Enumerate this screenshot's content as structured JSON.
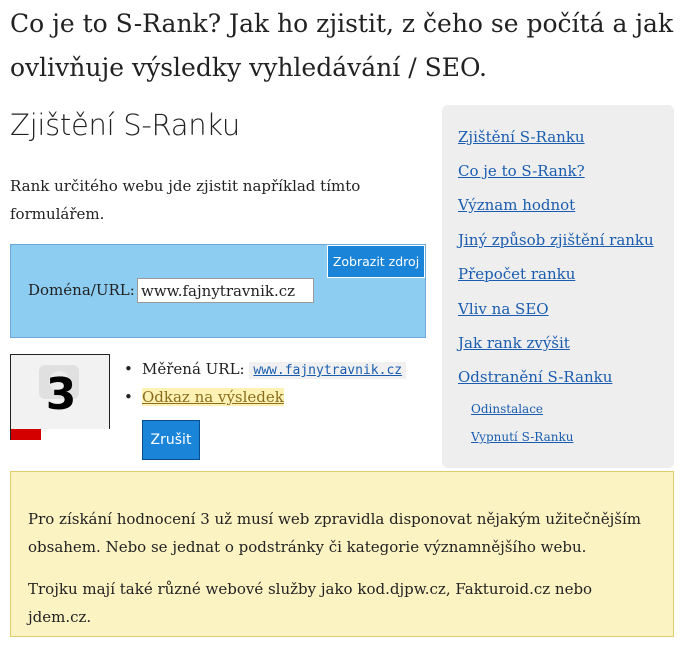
{
  "page_title": "Co je to S-Rank? Jak ho zjistit, z čeho se počítá a jak ovlivňuje výsledky vyhledávání / SEO.",
  "section_heading": "Zjištění S-Ranku",
  "intro_text": "Rank určitého webu jde zjistit například tímto formulářem.",
  "form": {
    "show_source_label": "Zobrazit zdroj",
    "domain_label": "Doména/URL:",
    "domain_value": "www.fajnytravnik.cz"
  },
  "result": {
    "rank_value": "3",
    "rank_fraction": 0.3,
    "rank_bar_color": "#d40000",
    "measured_url_label": "Měřená URL:",
    "measured_url": "www.fajnytravnik.cz",
    "result_link_label": "Odkaz na výsledek",
    "cancel_label": "Zrušit"
  },
  "toc": {
    "items": [
      "Zjištění S-Ranku",
      "Co je to S-Rank?",
      "Význam hodnot",
      "Jiný způsob zjištění ranku",
      "Přepočet ranku",
      "Vliv na SEO",
      "Jak rank zvýšit",
      "Odstranění S-Ranku"
    ],
    "subitems": [
      "Odinstalace",
      "Vypnutí S-Ranku"
    ]
  },
  "note": {
    "paragraph_1": "Pro získání hodnocení 3 už musí web zpravidla disponovat nějakým užitečnějším obsahem. Nebo se jednat o podstránky či kategorie významnějšího webu.",
    "paragraph_2": "Trojku mají také různé webové služby jako kod.djpw.cz, Fakturoid.cz nebo jdem.cz."
  },
  "colors": {
    "form_bg": "#8ecdf2",
    "button_bg": "#1a84d9",
    "toc_bg": "#eeeeee",
    "note_bg": "#fcf3c3",
    "link": "#1a5db0"
  }
}
